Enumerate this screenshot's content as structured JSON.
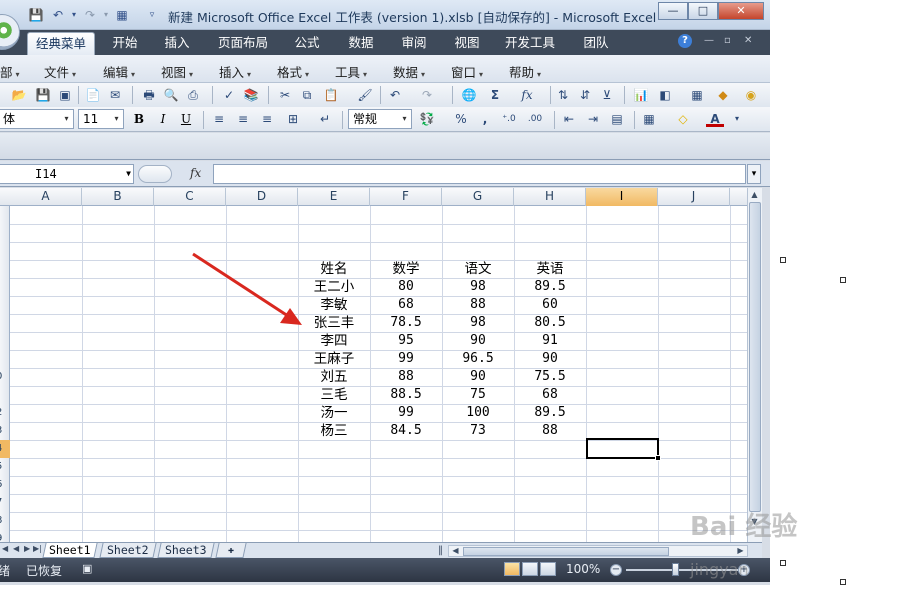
{
  "window": {
    "title": "新建 Microsoft Office Excel 工作表 (version 1).xlsb [自动保存的] - Microsoft Excel",
    "controls": {
      "minimize": "—",
      "maximize": "□",
      "close": "✕"
    }
  },
  "ribbon_tabs": [
    {
      "label": "经典菜单",
      "active": true
    },
    {
      "label": "开始"
    },
    {
      "label": "插入"
    },
    {
      "label": "页面布局"
    },
    {
      "label": "公式"
    },
    {
      "label": "数据"
    },
    {
      "label": "审阅"
    },
    {
      "label": "视图"
    },
    {
      "label": "开发工具"
    },
    {
      "label": "团队"
    }
  ],
  "help_label": "?",
  "menus": [
    "部",
    "文件",
    "编辑",
    "视图",
    "插入",
    "格式",
    "工具",
    "数据",
    "窗口",
    "帮助"
  ],
  "toolbar": {
    "font_name": "体",
    "font_size": "11",
    "bold": "B",
    "italic": "I",
    "underline": "U",
    "number_format": "常规",
    "percent": "%",
    "comma": ",",
    "sigma": "Σ",
    "fx": "fx"
  },
  "formula_bar": {
    "name_box": "I14",
    "fx_label": "fx",
    "value": ""
  },
  "grid": {
    "columns": [
      "A",
      "B",
      "C",
      "D",
      "E",
      "F",
      "G",
      "H",
      "I",
      "J"
    ],
    "selected_column": "I",
    "active_cell": "I14",
    "table_header": [
      "姓名",
      "数学",
      "语文",
      "英语"
    ],
    "table_rows": [
      [
        "王二小",
        "80",
        "98",
        "89.5"
      ],
      [
        "李敏",
        "68",
        "88",
        "60"
      ],
      [
        "张三丰",
        "78.5",
        "98",
        "80.5"
      ],
      [
        "李四",
        "95",
        "90",
        "91"
      ],
      [
        "王麻子",
        "99",
        "96.5",
        "90"
      ],
      [
        "刘五",
        "88",
        "90",
        "75.5"
      ],
      [
        "三毛",
        "88.5",
        "75",
        "68"
      ],
      [
        "汤一",
        "99",
        "100",
        "89.5"
      ],
      [
        "杨三",
        "84.5",
        "73",
        "88"
      ]
    ],
    "row_header_labels": [
      "",
      "",
      "",
      "",
      "",
      "",
      "",
      "",
      "",
      "0",
      "",
      "2",
      "3",
      "4",
      "5",
      "6",
      "7",
      "8",
      "9"
    ]
  },
  "sheets": [
    {
      "label": "Sheet1",
      "active": true
    },
    {
      "label": "Sheet2"
    },
    {
      "label": "Sheet3"
    }
  ],
  "status": {
    "ready": "绪",
    "recovered": "已恢复",
    "zoom": "100%"
  },
  "annotation": {
    "arrow_color": "#d9281f"
  },
  "watermark": {
    "text": "Bai 经验",
    "sub": "jingyan"
  },
  "colors": {
    "tab_bar": "#3e4a5a",
    "selected_header": "#f1b963",
    "grid_line": "#d0d7e5"
  }
}
